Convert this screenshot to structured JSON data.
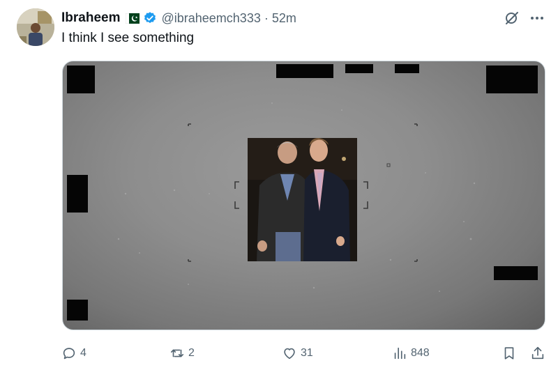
{
  "post": {
    "display_name": "Ibraheem",
    "handle": "@ibraheemch333",
    "separator": "·",
    "timestamp": "52m",
    "text": "I think I see something",
    "flag_icon": "pakistan-flag-icon",
    "verified_icon": "verified-badge-icon"
  },
  "header_actions": {
    "grok_icon": "grok-icon",
    "more_icon": "more-options-icon"
  },
  "media": {
    "description_icon": "photo-inset"
  },
  "actions": {
    "replies": "4",
    "reposts": "2",
    "likes": "31",
    "views": "848"
  },
  "colors": {
    "text_primary": "#0f1419",
    "text_secondary": "#536471",
    "verified_blue": "#1d9bf0",
    "border": "#cfd9de"
  }
}
